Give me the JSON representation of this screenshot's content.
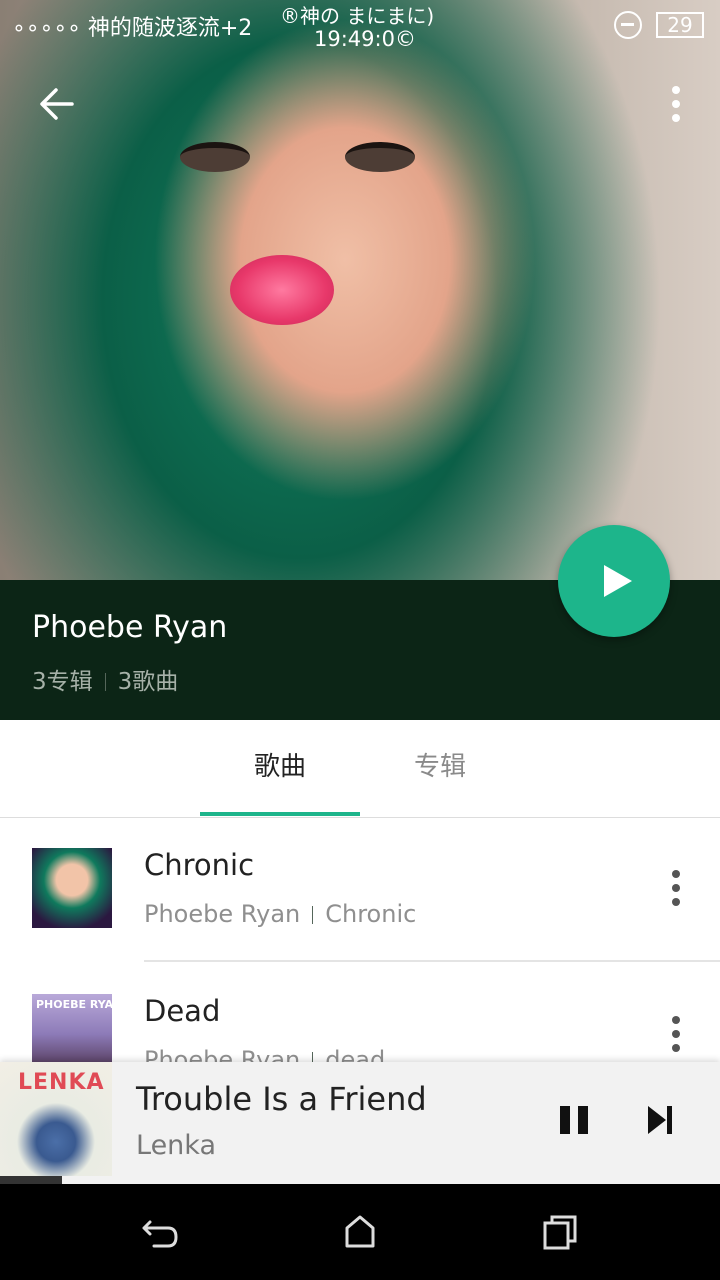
{
  "status_bar": {
    "left_text": "∘∘∘∘∘ 神的随波逐流+2",
    "center_top": "®神の まにまに)",
    "center_time": "19:49:0©",
    "battery": "29"
  },
  "header": {
    "back_icon": "arrow-left-icon",
    "more_icon": "more-vertical-icon"
  },
  "artist": {
    "name": "Phoebe Ryan",
    "albums": "3专辑",
    "songs": "3歌曲",
    "play_icon": "play-icon",
    "accent_color": "#1db58b"
  },
  "tabs": [
    {
      "label": "歌曲",
      "active": true
    },
    {
      "label": "专辑",
      "active": false
    }
  ],
  "songs": [
    {
      "title": "Chronic",
      "artist": "Phoebe Ryan",
      "album": "Chronic",
      "thumb_text": ""
    },
    {
      "title": "Dead",
      "artist": "Phoebe Ryan",
      "album": "dead",
      "thumb_text": "PHOEBE RYAN"
    }
  ],
  "now_playing": {
    "title": "Trouble Is a Friend",
    "artist": "Lenka",
    "art_text": "LENKA",
    "pause_icon": "pause-icon",
    "next_icon": "skip-next-icon"
  },
  "nav": {
    "back_icon": "nav-back-icon",
    "home_icon": "nav-home-icon",
    "recents_icon": "nav-recents-icon"
  }
}
